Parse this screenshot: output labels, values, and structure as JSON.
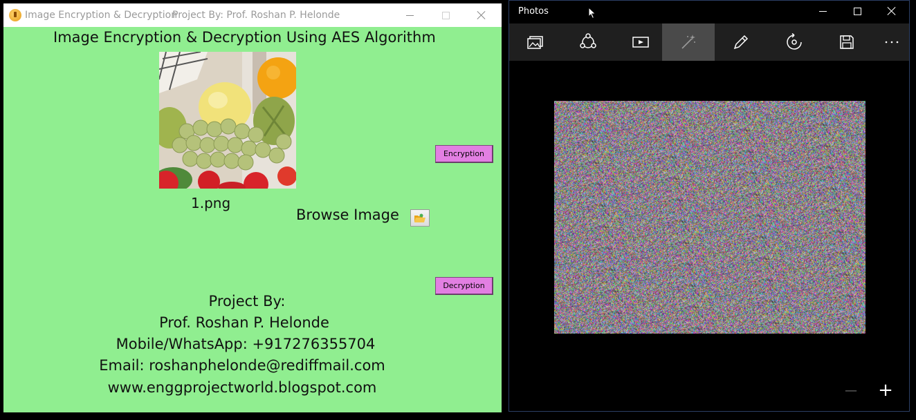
{
  "app": {
    "title": "Image Encryption & Decryption",
    "subtitle": "Project By: Prof. Roshan P. Helonde",
    "heading": "Image Encryption & Decryption Using AES Algorithm",
    "filename": "1.png",
    "browse_label": "Browse Image",
    "encryption_label": "Encryption",
    "decryption_label": "Decryption",
    "credits": [
      "Project By:",
      "Prof. Roshan P. Helonde",
      "Mobile/WhatsApp: +917276355704",
      "Email: roshanphelonde@rediffmail.com",
      "www.enggprojectworld.blogspot.com"
    ],
    "bg_color": "#90EE90",
    "button_color": "#E27FE2"
  },
  "photos": {
    "title": "Photos",
    "toolbar": [
      {
        "icon": "collection-icon"
      },
      {
        "icon": "share-icon"
      },
      {
        "icon": "slideshow-icon"
      },
      {
        "icon": "enhance-icon",
        "active": true
      },
      {
        "icon": "edit-icon"
      },
      {
        "icon": "rotate-icon"
      },
      {
        "icon": "save-icon"
      },
      {
        "icon": "more-icon"
      }
    ],
    "zoom_out_label": "—",
    "zoom_in_label": "+"
  }
}
